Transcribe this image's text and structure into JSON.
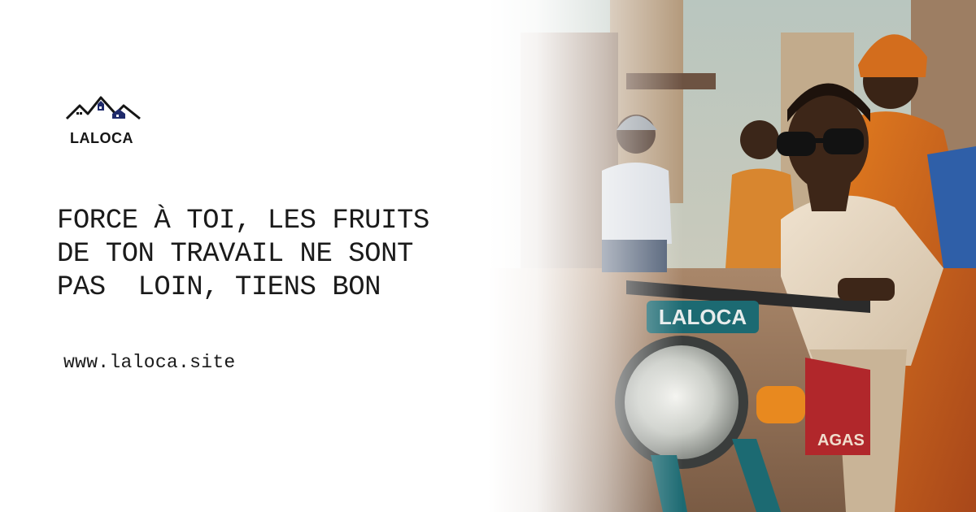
{
  "brand": {
    "name": "LALOCA",
    "logo_icon": "houses-roof-icon",
    "accent": "#1f2a6b",
    "text_color": "#151515"
  },
  "headline": {
    "lines": [
      "FORCE À TOI, LES FRUITS",
      "DE TON TRAVAIL NE SONT",
      "PAS  LOIN, TIENS BON"
    ]
  },
  "website": "www.laloca.site",
  "photo": {
    "plate_text": "LALOCA",
    "tank_text": "AGAS"
  }
}
